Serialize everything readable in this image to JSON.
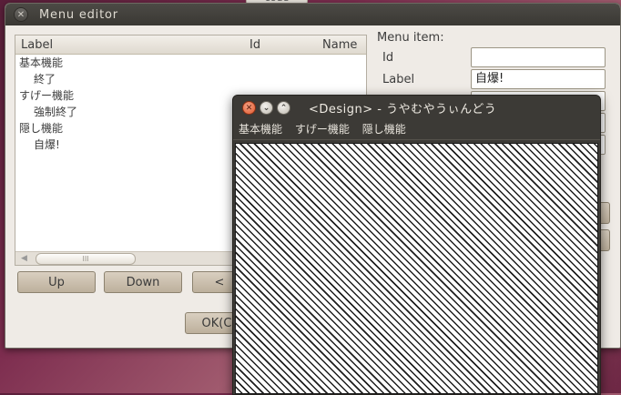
{
  "background_tab": {
    "label": "code"
  },
  "menu_editor": {
    "title": "Menu editor",
    "tree": {
      "columns": [
        "Label",
        "Id",
        "Name"
      ],
      "rows": [
        {
          "label": "基本機能",
          "child": false
        },
        {
          "label": "終了",
          "child": true
        },
        {
          "label": "すげー機能",
          "child": false
        },
        {
          "label": "強制終了",
          "child": true
        },
        {
          "label": "隠し機能",
          "child": false
        },
        {
          "label": "自爆!",
          "child": true
        }
      ],
      "scroll_thumb": "III"
    },
    "buttons": {
      "up": "Up",
      "down": "Down",
      "left_partial": "<",
      "ok_partial": "OK(C"
    },
    "menu_item": {
      "group_title": "Menu item:",
      "id_label": "Id",
      "id_value": "",
      "label_label": "Label",
      "label_value": "自爆!"
    }
  },
  "design_window": {
    "title": "<Design> - うやむやうぃんどう",
    "menus": [
      "基本機能",
      "すげー機能",
      "隠し機能"
    ]
  }
}
